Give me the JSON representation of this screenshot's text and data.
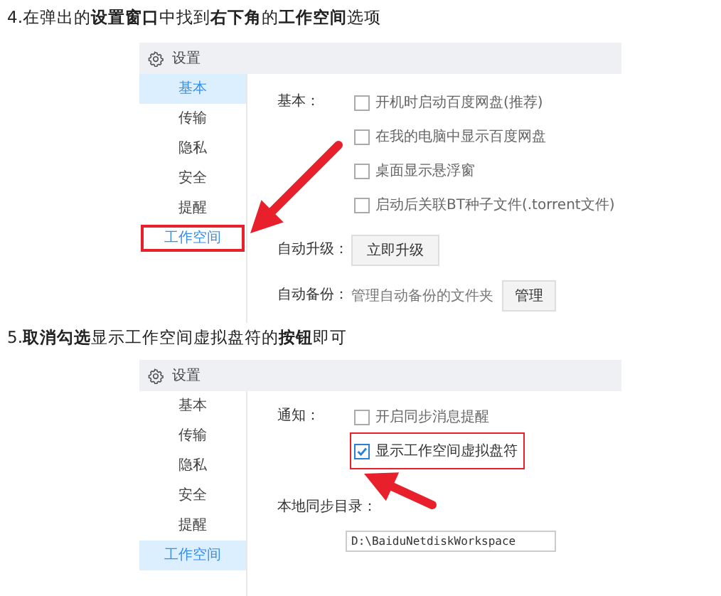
{
  "steps": [
    {
      "heading": "4.在弹出的**设置窗口**中找到**右下角**的**工作空间**选项",
      "window": {
        "title": "设置",
        "sidebar": [
          {
            "label": "基本",
            "selected": true,
            "highlighted": false
          },
          {
            "label": "传输",
            "selected": false,
            "highlighted": false
          },
          {
            "label": "隐私",
            "selected": false,
            "highlighted": false
          },
          {
            "label": "安全",
            "selected": false,
            "highlighted": false
          },
          {
            "label": "提醒",
            "selected": false,
            "highlighted": false
          },
          {
            "label": "工作空间",
            "selected": false,
            "highlighted": true
          }
        ],
        "rows": [
          {
            "kind": "checks",
            "label": "基本：",
            "items": [
              {
                "label": "开机时启动百度网盘(推荐)",
                "checked": false,
                "highlighted": false
              },
              {
                "label": "在我的电脑中显示百度网盘",
                "checked": false,
                "highlighted": false
              },
              {
                "label": "桌面显示悬浮窗",
                "checked": false,
                "highlighted": false
              },
              {
                "label": "启动后关联BT种子文件(.torrent文件)",
                "checked": false,
                "highlighted": false
              }
            ]
          },
          {
            "kind": "button",
            "label": "自动升级：",
            "button": "立即升级"
          },
          {
            "kind": "manage",
            "label": "自动备份：",
            "text": "管理自动备份的文件夹",
            "button": "管理"
          }
        ]
      }
    },
    {
      "heading": "5.**取消勾选**显示工作空间虚拟盘符的**按钮**即可",
      "window": {
        "title": "设置",
        "sidebar": [
          {
            "label": "基本",
            "selected": false,
            "highlighted": false
          },
          {
            "label": "传输",
            "selected": false,
            "highlighted": false
          },
          {
            "label": "隐私",
            "selected": false,
            "highlighted": false
          },
          {
            "label": "安全",
            "selected": false,
            "highlighted": false
          },
          {
            "label": "提醒",
            "selected": false,
            "highlighted": false
          },
          {
            "label": "工作空间",
            "selected": true,
            "highlighted": false
          }
        ],
        "rows": [
          {
            "kind": "checks",
            "label": "通知：",
            "items": [
              {
                "label": "开启同步消息提醒",
                "checked": false,
                "highlighted": false
              },
              {
                "label": "显示工作空间虚拟盘符",
                "checked": true,
                "highlighted": true
              }
            ]
          },
          {
            "kind": "path",
            "label": "本地同步目录：",
            "value": "D:\\BaiduNetdiskWorkspace"
          }
        ]
      }
    }
  ]
}
